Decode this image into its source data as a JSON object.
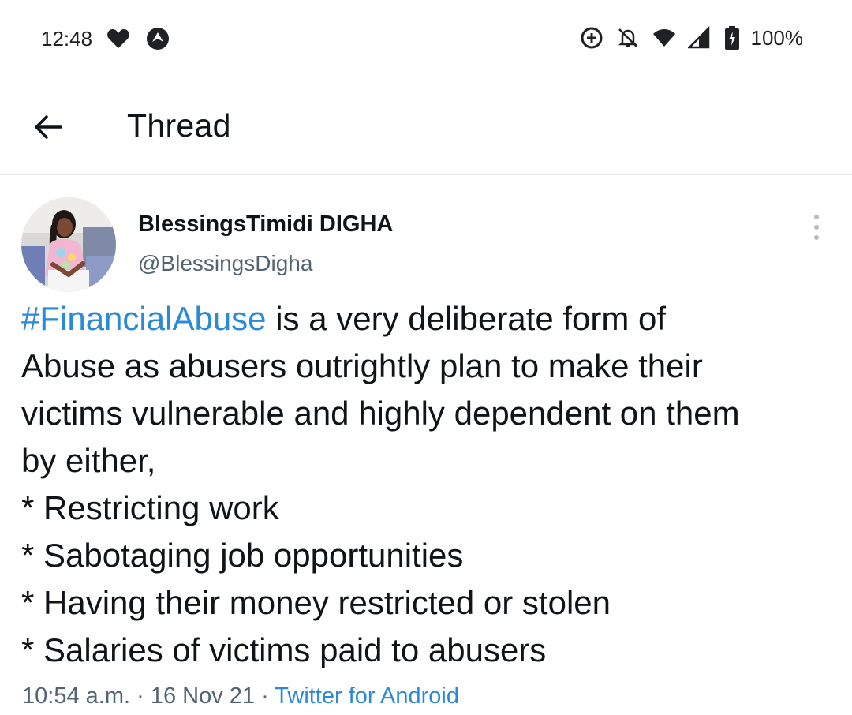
{
  "status_bar": {
    "time": "12:48",
    "battery_pct": "100%",
    "icons": [
      "heart-icon",
      "navigation-icon",
      "data-saver-icon",
      "notifications-off-icon",
      "wifi-icon",
      "cell-signal-icon",
      "battery-charging-icon"
    ]
  },
  "header": {
    "title": "Thread",
    "back_icon": "arrow-left-icon"
  },
  "tweet": {
    "display_name": "BlessingsTimidi DIGHA",
    "handle": "@BlessingsDigha",
    "hashtag": "#FinancialAbuse",
    "line1_rest": " is a very deliberate form of",
    "line2": "Abuse as abusers outrightly plan to make their",
    "line3": "victims vulnerable and highly dependent on them",
    "line4": "by either,",
    "line5": "* Restricting work",
    "line6": "* Sabotaging job opportunities",
    "line7": "* Having their money restricted or stolen",
    "line8": "* Salaries of victims paid to abusers",
    "time": "10:54 a.m.",
    "separator": " · ",
    "date": "16 Nov 21",
    "source": "Twitter for Android"
  },
  "colors": {
    "link": "#2a8ad6",
    "secondary_text": "#536471",
    "divider": "#e3e6e8"
  }
}
